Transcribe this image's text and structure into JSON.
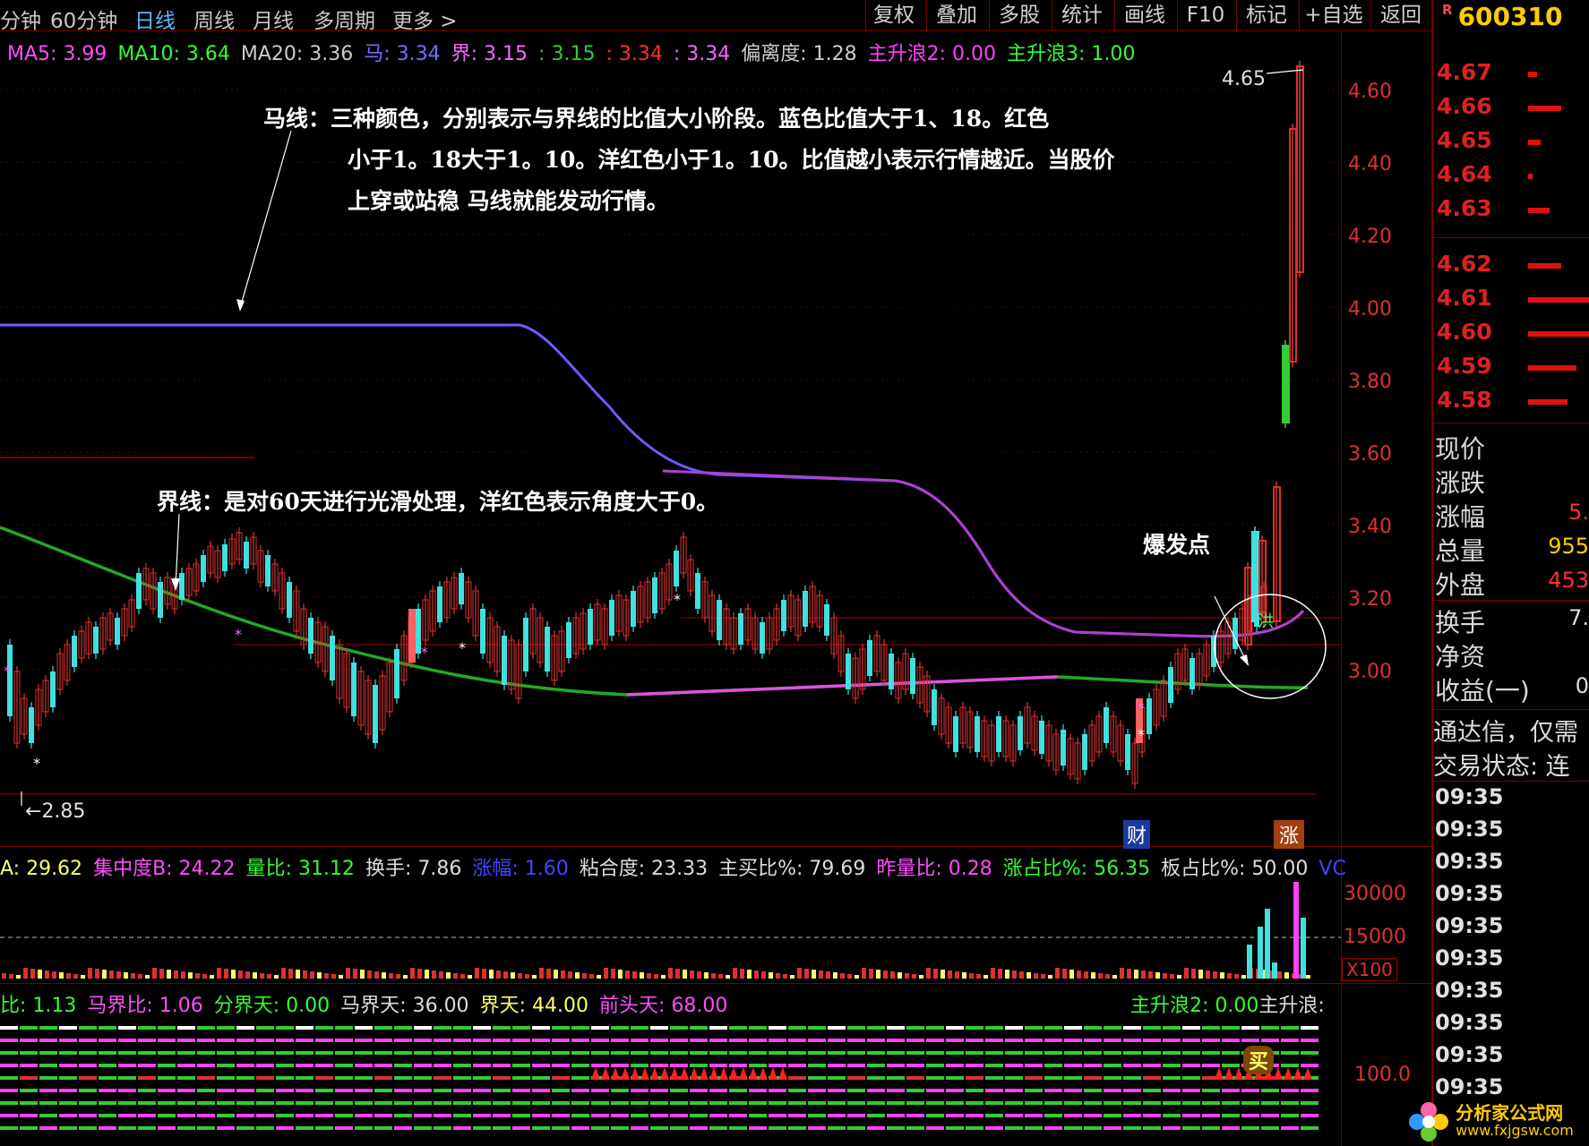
{
  "toolbar": {
    "periods": [
      "分钟",
      "60分钟",
      "日线",
      "周线",
      "月线",
      "多周期",
      "更多 >"
    ],
    "buttons": [
      "复权",
      "叠加",
      "多股",
      "统计",
      "画线",
      "F10",
      "标记",
      "+自选",
      "返回"
    ]
  },
  "stock": {
    "r_mark": "R",
    "code": "600310"
  },
  "ma_row": [
    {
      "text": "MA5: 3.99",
      "color": "#ff4dff"
    },
    {
      "text": "MA10: 3.64",
      "color": "#33ff33"
    },
    {
      "text": "MA20: 3.36",
      "color": "#cccccc"
    },
    {
      "text": "马: 3.34",
      "color": "#7070ff"
    },
    {
      "text": "界: 3.15",
      "color": "#ff66ff"
    },
    {
      "text": ": 3.15",
      "color": "#33cc33"
    },
    {
      "text": ": 3.34",
      "color": "#ff3030"
    },
    {
      "text": ": 3.34",
      "color": "#ff66ff"
    },
    {
      "text": "偏离度: 1.28",
      "color": "#cccccc"
    },
    {
      "text": "主升浪2: 0.00",
      "color": "#ff40ff"
    },
    {
      "text": "主升浪3: 1.00",
      "color": "#33ff33"
    }
  ],
  "price_axis": [
    "4.60",
    "4.40",
    "4.20",
    "4.00",
    "3.80",
    "3.60",
    "3.40",
    "3.20",
    "3.00"
  ],
  "annotations": {
    "ma_line": [
      "马线：三种颜色，分别表示与界线的比值大小阶段。蓝色比值大于1、18。红色",
      "小于1。18大于1。10。洋红色小于1。10。比值越小表示行情越近。当股价",
      "上穿或站稳 马线就能发动行情。"
    ],
    "boundary_line": "界线：是对60天进行光滑处理，洋红色表示角度大于0。",
    "burst_point": "爆发点",
    "high_label": "4.65",
    "low_label": "2.85",
    "cai_tag": "财",
    "zhang_tag": "涨",
    "hong_tag": "洪"
  },
  "indicator1": [
    {
      "text": "A: 29.62",
      "color": "#ffff66"
    },
    {
      "text": "集中度B: 24.22",
      "color": "#ff4dff"
    },
    {
      "text": "量比: 31.12",
      "color": "#33ff33"
    },
    {
      "text": "换手: 7.86",
      "color": "#dddddd"
    },
    {
      "text": "涨幅: 1.60",
      "color": "#4444ff"
    },
    {
      "text": "粘合度: 23.33",
      "color": "#dddddd"
    },
    {
      "text": "主买比%: 79.69",
      "color": "#dddddd"
    },
    {
      "text": "昨量比: 0.28",
      "color": "#ff4dff"
    },
    {
      "text": "涨占比%: 56.35",
      "color": "#33ff33"
    },
    {
      "text": "板占比%: 50.00",
      "color": "#dddddd"
    },
    {
      "text": "VC",
      "color": "#4444ff"
    }
  ],
  "volume_axis": [
    "30000",
    "15000"
  ],
  "volume_unit": "X100",
  "indicator2": [
    {
      "text": "比: 1.13",
      "color": "#33ff33"
    },
    {
      "text": "马界比: 1.06",
      "color": "#ff4dff"
    },
    {
      "text": "分界天: 0.00",
      "color": "#33ff33"
    },
    {
      "text": "马界天: 36.00",
      "color": "#dddddd"
    },
    {
      "text": "界天: 44.00",
      "color": "#ffff66"
    },
    {
      "text": "前头天: 68.00",
      "color": "#ff4dff"
    }
  ],
  "indicator2_right": [
    {
      "text": "主升浪2: 0.00",
      "color": "#33ff33"
    },
    {
      "text": "主升浪:",
      "color": "#dddddd"
    }
  ],
  "ind2_axis": "100.0",
  "buy_tag": "买",
  "orderbook": [
    {
      "price": "4.67",
      "bar": 0.15
    },
    {
      "price": "4.66",
      "bar": 0.55
    },
    {
      "price": "4.65",
      "bar": 0.2
    },
    {
      "price": "4.64",
      "bar": 0.08
    },
    {
      "price": "4.63",
      "bar": 0.35
    },
    {
      "price": "4.62",
      "bar": 0.55
    },
    {
      "price": "4.61",
      "bar": 1.0
    },
    {
      "price": "4.60",
      "bar": 1.0
    },
    {
      "price": "4.59",
      "bar": 0.8
    },
    {
      "price": "4.58",
      "bar": 0.65
    }
  ],
  "quote": [
    {
      "label": "现价",
      "value": "",
      "color": "#ff3030"
    },
    {
      "label": "涨跌",
      "value": "",
      "color": "#ff3030"
    },
    {
      "label": "涨幅",
      "value": "5.",
      "color": "#ff3030"
    },
    {
      "label": "总量",
      "value": "955",
      "color": "#ffcc00"
    },
    {
      "label": "外盘",
      "value": "453",
      "color": "#ff3030"
    },
    {
      "label": "换手",
      "value": "7.",
      "color": "#dddddd"
    },
    {
      "label": "净资",
      "value": "",
      "color": "#dddddd"
    },
    {
      "label": "收益(一)",
      "value": "0",
      "color": "#dddddd"
    }
  ],
  "info": {
    "broker": "通达信，仅需",
    "status": "交易状态: 连"
  },
  "times": [
    "09:35",
    "09:35",
    "09:35",
    "09:35",
    "09:35",
    "09:35",
    "09:35",
    "09:35",
    "09:35",
    "09:35"
  ],
  "watermark": {
    "cn": "分析家公式网",
    "url": "www.fxjgsw.com"
  }
}
